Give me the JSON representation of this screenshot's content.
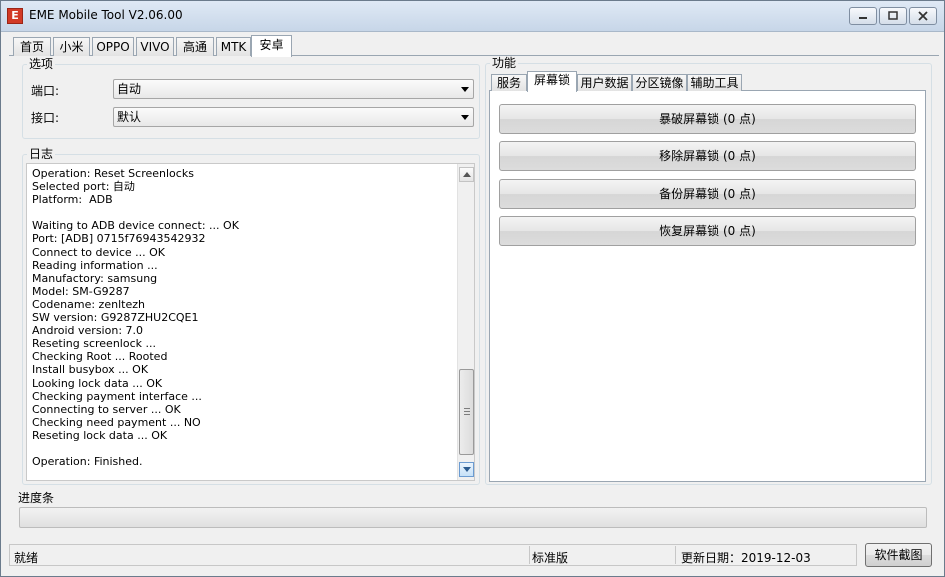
{
  "window": {
    "title": "EME Mobile Tool V2.06.00",
    "icon_letter": "E"
  },
  "top_tabs": [
    {
      "label": "首页"
    },
    {
      "label": "小米"
    },
    {
      "label": "OPPO"
    },
    {
      "label": "VIVO"
    },
    {
      "label": "高通"
    },
    {
      "label": "MTK"
    },
    {
      "label": "安卓",
      "active": true
    }
  ],
  "options": {
    "title": "选项",
    "port_label": "端口:",
    "port_value": "自动",
    "interface_label": "接口:",
    "interface_value": "默认"
  },
  "log": {
    "title": "日志",
    "lines": [
      "Operation: Reset Screenlocks",
      "Selected port: 自动",
      "Platform:  ADB",
      "",
      "Waiting to ADB device connect: ... OK",
      "Port: [ADB] 0715f76943542932",
      "Connect to device ... OK",
      "Reading information ...",
      "Manufactory: samsung",
      "Model: SM-G9287",
      "Codename: zenltezh",
      "SW version: G9287ZHU2CQE1",
      "Android version: 7.0",
      "Reseting screenlock ...",
      "Checking Root ... Rooted",
      "Install busybox ... OK",
      "Looking lock data ... OK",
      "Checking payment interface ...",
      "Connecting to server ... OK",
      "Checking need payment ... NO",
      "Reseting lock data ... OK",
      "",
      "Operation: Finished."
    ]
  },
  "functions": {
    "title": "功能",
    "tabs": [
      {
        "label": "服务"
      },
      {
        "label": "屏幕锁",
        "active": true
      },
      {
        "label": "用户数据"
      },
      {
        "label": "分区镜像"
      },
      {
        "label": "辅助工具"
      }
    ],
    "buttons": [
      {
        "label": "暴破屏幕锁 (0 点)"
      },
      {
        "label": "移除屏幕锁 (0 点)"
      },
      {
        "label": "备份屏幕锁 (0 点)"
      },
      {
        "label": "恢复屏幕锁 (0 点)"
      }
    ]
  },
  "progress": {
    "label": "进度条",
    "percent": 0
  },
  "status": {
    "state": "就绪",
    "edition": "标准版",
    "update_date": "更新日期：2019-12-03",
    "screenshot_button": "软件截图"
  },
  "colors": {
    "progress_fill": "#06b025",
    "app_icon": "#d23a26"
  }
}
